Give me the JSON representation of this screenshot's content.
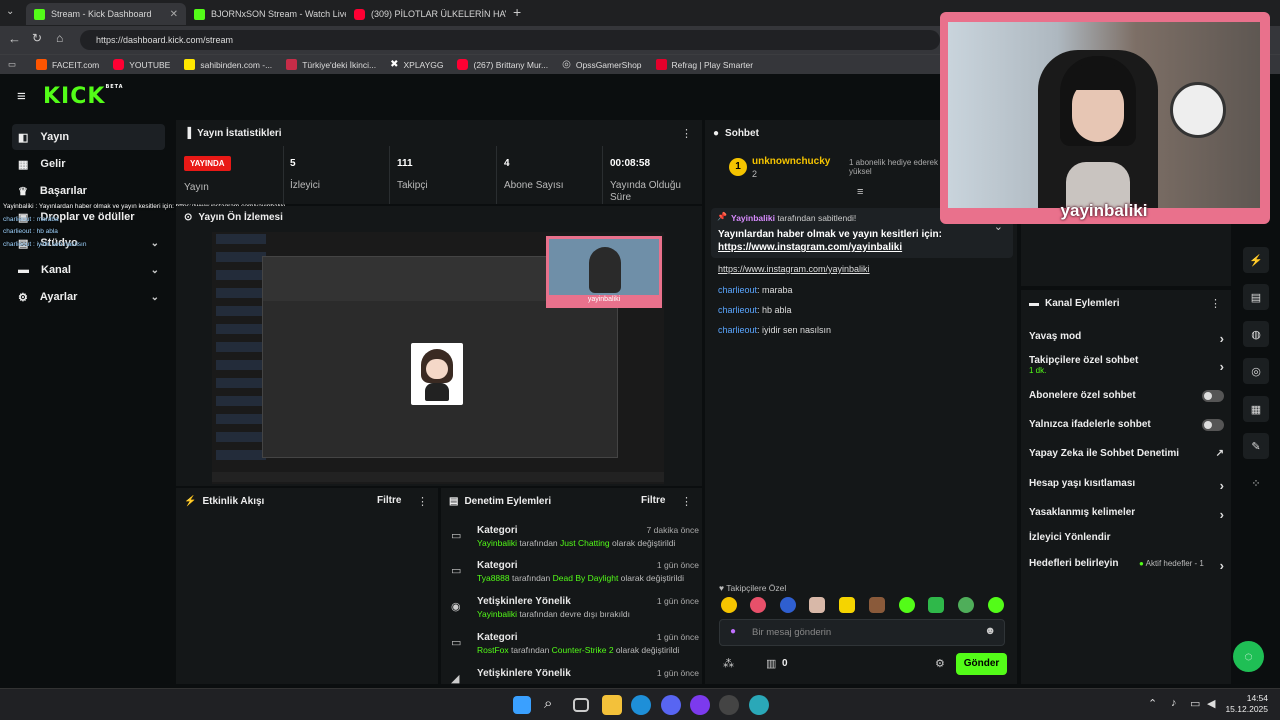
{
  "browser": {
    "tabs": [
      {
        "title": "Stream - Kick Dashboard",
        "color": "#53fc18"
      },
      {
        "title": "BJORNxSON Stream - Watch Live o",
        "color": "#53fc18"
      },
      {
        "title": "(309) PİLOTLAR ÜLKELERİN HAVAY",
        "color": "#ff0033"
      }
    ],
    "url": "https://dashboard.kick.com/stream",
    "bookmarks": [
      "FACEIT.com",
      "YOUTUBE",
      "sahibinden.com -...",
      "Türkiye'deki İkinci...",
      "XPLAYGG",
      "(267) Brittany Mur...",
      "OpssGamerShop",
      "Refrag | Play Smarter"
    ]
  },
  "brand": {
    "logo": "KICK",
    "badge": "BETA",
    "accent": "#53fc18"
  },
  "sidebar": {
    "items": [
      {
        "label": "Yayın",
        "icon": "broadcast-icon"
      },
      {
        "label": "Gelir",
        "icon": "revenue-icon"
      },
      {
        "label": "Başarılar",
        "icon": "trophy-icon"
      },
      {
        "label": "Droplar ve ödüller",
        "icon": "gift-icon"
      },
      {
        "label": "Stüdyo",
        "icon": "studio-icon"
      },
      {
        "label": "Kanal",
        "icon": "channel-icon"
      },
      {
        "label": "Ayarlar",
        "icon": "gear-icon"
      }
    ]
  },
  "overlay_chat": [
    "Yayinbaliki : Yayınlardan haber olmak ve yayın kesitleri için: https://www.instagram.com/yayinbaliki",
    "charlieout : maraba",
    "charlieout : hb abla",
    "charlieout : iyidir sen nasılsın"
  ],
  "stats": {
    "title": "Yayın İstatistikleri",
    "live_badge": "YAYINDA",
    "items": [
      {
        "value": "",
        "label": "Yayın"
      },
      {
        "value": "5",
        "label": "İzleyici"
      },
      {
        "value": "111",
        "label": "Takipçi"
      },
      {
        "value": "4",
        "label": "Abone Sayısı"
      },
      {
        "value": "00:08:58",
        "label": "Yayında Olduğu Süre"
      }
    ]
  },
  "preview": {
    "title": "Yayın Ön İzlemesi",
    "cam_name": "yayinbaliki"
  },
  "activity": {
    "title": "Etkinlik Akışı",
    "filter": "Filtre"
  },
  "moderation": {
    "title": "Denetim Eylemleri",
    "filter": "Filtre",
    "rows": [
      {
        "title": "Kategori",
        "time": "7 dakika önce",
        "user": "Yayinbaliki",
        "mid": " tarafından ",
        "target": "Just Chatting",
        "rest": " olarak değiştirildi",
        "icon": "category-icon"
      },
      {
        "title": "Kategori",
        "time": "1 gün önce",
        "user": "Tya8888",
        "mid": " tarafından ",
        "target": "Dead By Daylight",
        "rest": " olarak değiştirildi",
        "icon": "category-icon"
      },
      {
        "title": "Yetişkinlere Yönelik",
        "time": "1 gün önce",
        "user": "Yayinbaliki",
        "mid": " tarafından devre dışı bırakıldı",
        "target": "",
        "rest": "",
        "icon": "eye-icon"
      },
      {
        "title": "Kategori",
        "time": "1 gün önce",
        "user": "RostFox",
        "mid": " tarafından ",
        "target": "Counter-Strike 2",
        "rest": " olarak değiştirildi",
        "icon": "category-icon"
      },
      {
        "title": "Yetişkinlere Yönelik",
        "time": "1 gün önce",
        "user": "",
        "mid": "",
        "target": "",
        "rest": "",
        "icon": "adult-icon"
      }
    ]
  },
  "chat": {
    "title": "Sohbet",
    "top_user": "unknownchucky",
    "top_rank": "1",
    "top_count": "2",
    "gift_note": "1 abonelik hediye ederek yüksel",
    "pinned_by": "Yayinbaliki",
    "pinned_suffix": " tarafından sabitlendi!",
    "pinned_text": "Yayınlardan haber olmak ve yayın kesitleri için:",
    "pinned_link": "https://www.instagram.com/yayinbaliki",
    "messages": [
      {
        "user": "",
        "text": "https://www.instagram.com/yayinbaliki"
      },
      {
        "user": "charlieout",
        "text": ": maraba"
      },
      {
        "user": "charlieout",
        "text": ": hb abla"
      },
      {
        "user": "charlieout",
        "text": ": iyidir sen nasılsın"
      }
    ],
    "followers_only": "Takipçilere Özel",
    "input_placeholder": "Bir mesaj gönderin",
    "points": "0",
    "send": "Gönder"
  },
  "channel_actions": {
    "title": "Kanal Eylemleri",
    "items": [
      {
        "label": "Yavaş mod",
        "sub": "",
        "control": "arrow"
      },
      {
        "label": "Takipçilere özel sohbet",
        "sub": "1 dk.",
        "control": "arrow"
      },
      {
        "label": "Abonelere özel sohbet",
        "sub": "",
        "control": "toggle"
      },
      {
        "label": "Yalnızca ifadelerle sohbet",
        "sub": "",
        "control": "toggle"
      },
      {
        "label": "Yapay Zeka ile Sohbet Denetimi",
        "sub": "",
        "control": "external"
      },
      {
        "label": "Hesap yaşı kısıtlaması",
        "sub": "",
        "control": "arrow"
      },
      {
        "label": "Yasaklanmış kelimeler",
        "sub": "",
        "control": "arrow"
      },
      {
        "label": "İzleyici Yönlendir",
        "sub": "",
        "control": "none"
      },
      {
        "label": "Hedefleri belirleyin",
        "sub": "",
        "control": "arrow"
      }
    ],
    "goals_status": "Aktif hedefler - 1"
  },
  "webcam": {
    "name": "yayinbaliki"
  },
  "taskbar": {
    "time": "14:54",
    "date": "15.12.2025"
  }
}
